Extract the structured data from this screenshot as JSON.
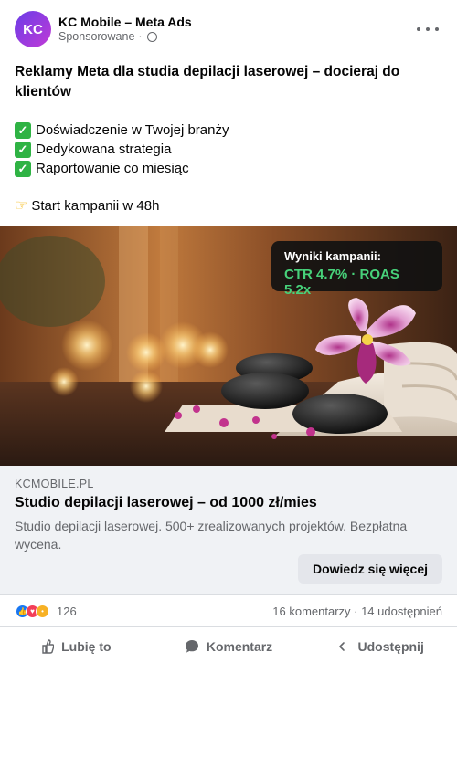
{
  "post": {
    "avatar_initials": "KC",
    "page_name": "KC Mobile – Meta Ads",
    "sponsored_label": "Sponsorowane",
    "separator": "·",
    "headline": "Reklamy Meta dla studia depilacji laserowej – docieraj do klientów",
    "bullets": [
      "Doświadczenie w Twojej branży",
      "Dedykowana strategia",
      "Raportowanie co miesiąc"
    ],
    "cta_line": "Start kampanii w 48h"
  },
  "hero": {
    "overlay_label": "Wyniki kampanii:",
    "overlay_value": "CTR 4.7% · ROAS 5.2x"
  },
  "link_preview": {
    "domain": "KCMOBILE.PL",
    "title": "Studio depilacji laserowej – od 1000 zł/mies",
    "description": "Studio depilacji laserowej. 500+ zrealizowanych projektów. Bezpłatna wycena.",
    "button_label": "Dowiedz się więcej"
  },
  "engagement": {
    "reaction_count": "126",
    "comments_shares": "16 komentarzy · 14 udostępnień"
  },
  "actions": {
    "like": "Lubię to",
    "comment": "Komentarz",
    "share": "Udostępnij"
  },
  "icons": {
    "more": "more-icon",
    "globe": "globe-icon",
    "check": "check-mark-icon",
    "hand": "pointing-hand-icon",
    "like": "thumbs-up-icon",
    "comment": "speech-bubble-icon",
    "share": "share-arrow-icon"
  },
  "colors": {
    "avatar_gradient_start": "#6a3de8",
    "avatar_gradient_end": "#c13ad6",
    "overlay_value": "#47d17a",
    "check": "#2fb344",
    "like": "#1877f2",
    "love": "#f33e58",
    "wow": "#f7b125"
  }
}
